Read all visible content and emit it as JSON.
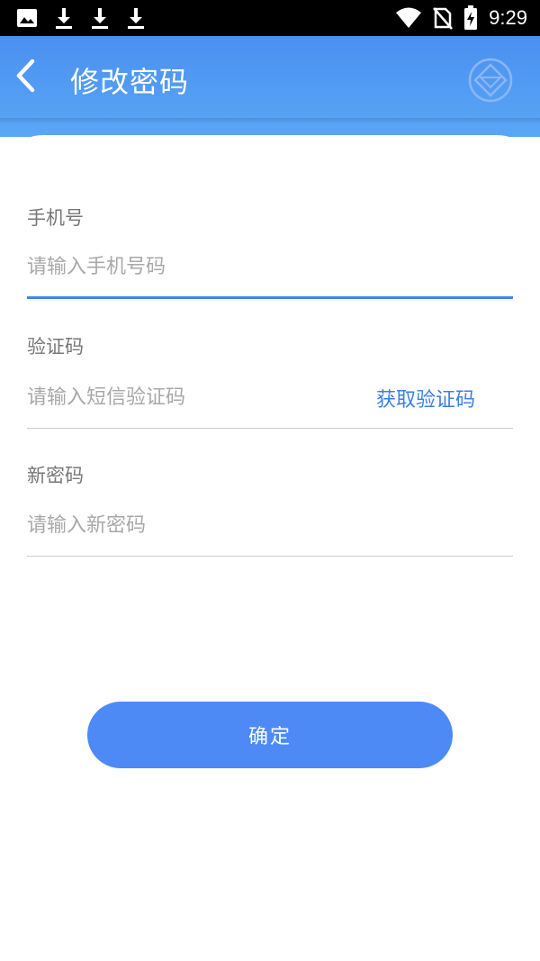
{
  "status_bar": {
    "time": "9:29",
    "left_icons": [
      "image-icon",
      "download-icon",
      "download-icon",
      "download-icon"
    ],
    "right_icons": [
      "wifi-icon",
      "no-sim-icon",
      "battery-charging-icon"
    ]
  },
  "header": {
    "title": "修改密码",
    "back_icon": "chevron-left-icon",
    "logo_icon": "app-logo-icon",
    "color": "#4a90f0"
  },
  "form": {
    "phone": {
      "label": "手机号",
      "placeholder": "请输入手机号码",
      "value": ""
    },
    "code": {
      "label": "验证码",
      "placeholder": "请输入短信验证码",
      "value": "",
      "get_code_label": "获取验证码"
    },
    "password": {
      "label": "新密码",
      "placeholder": "请输入新密码",
      "value": ""
    }
  },
  "confirm": {
    "label": "确定",
    "color": "#4d8af5"
  },
  "accent_color": "#3d86ea"
}
